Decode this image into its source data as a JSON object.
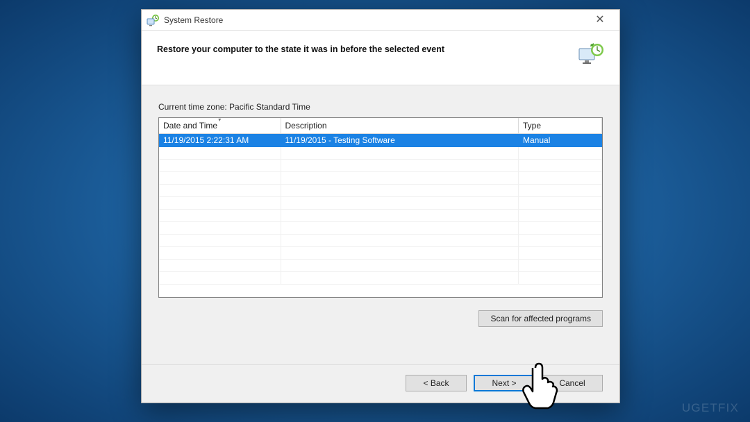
{
  "window": {
    "title": "System Restore",
    "close_glyph": "✕"
  },
  "header": {
    "heading": "Restore your computer to the state it was in before the selected event"
  },
  "body": {
    "timezone_label": "Current time zone: Pacific Standard Time",
    "columns": {
      "datetime": "Date and Time",
      "description": "Description",
      "type": "Type"
    },
    "rows": [
      {
        "datetime": "11/19/2015 2:22:31 AM",
        "description": "11/19/2015 - Testing Software",
        "type": "Manual",
        "selected": true
      }
    ],
    "scan_button": "Scan for affected programs"
  },
  "footer": {
    "back": "< Back",
    "next": "Next >",
    "cancel": "Cancel"
  },
  "watermark": "UGETFIX"
}
